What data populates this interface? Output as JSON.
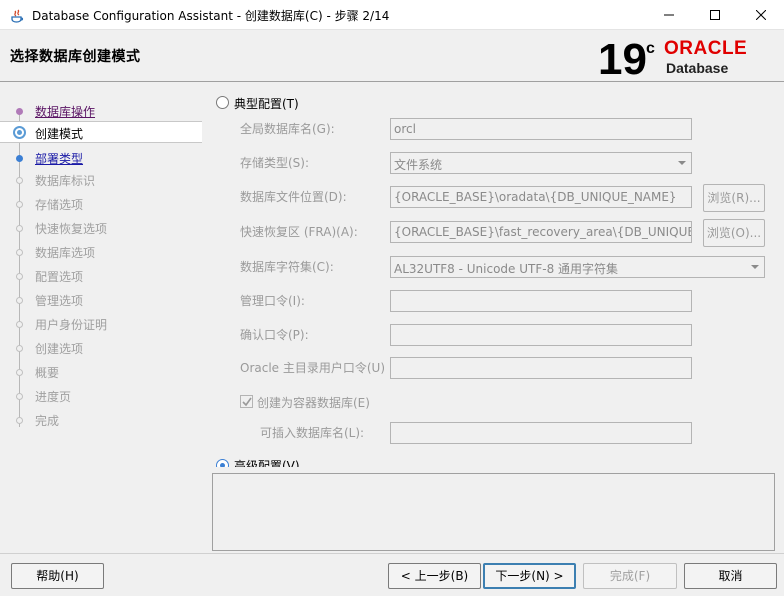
{
  "window": {
    "title": "Database Configuration Assistant - 创建数据库(C) - 步骤 2/14"
  },
  "header": {
    "heading": "选择数据库创建模式",
    "logo_version": "19",
    "logo_superscript": "c",
    "logo_brand": "ORACLE",
    "logo_product": "Database",
    "brand_color": "#e00000"
  },
  "nav": {
    "items": [
      {
        "label": "数据库操作",
        "state": "visited"
      },
      {
        "label": "创建模式",
        "state": "current"
      },
      {
        "label": "部署类型",
        "state": "link"
      },
      {
        "label": "数据库标识",
        "state": "disabled"
      },
      {
        "label": "存储选项",
        "state": "disabled"
      },
      {
        "label": "快速恢复选项",
        "state": "disabled"
      },
      {
        "label": "数据库选项",
        "state": "disabled"
      },
      {
        "label": "配置选项",
        "state": "disabled"
      },
      {
        "label": "管理选项",
        "state": "disabled"
      },
      {
        "label": "用户身份证明",
        "state": "disabled"
      },
      {
        "label": "创建选项",
        "state": "disabled"
      },
      {
        "label": "概要",
        "state": "disabled"
      },
      {
        "label": "进度页",
        "state": "disabled"
      },
      {
        "label": "完成",
        "state": "disabled"
      }
    ]
  },
  "form": {
    "typical_label": "典型配置(T)",
    "typical_selected": false,
    "global_db_name_label": "全局数据库名(G):",
    "global_db_name_value": "orcl",
    "storage_type_label": "存储类型(S):",
    "storage_type_value": "文件系统",
    "db_file_location_label": "数据库文件位置(D):",
    "db_file_location_value": "{ORACLE_BASE}\\oradata\\{DB_UNIQUE_NAME}",
    "browse_r_label": "浏览(R)...",
    "fra_label": "快速恢复区 (FRA)(A):",
    "fra_value": "{ORACLE_BASE}\\fast_recovery_area\\{DB_UNIQUE_NAME}",
    "browse_o_label": "浏览(O)...",
    "charset_label": "数据库字符集(C):",
    "charset_value": "AL32UTF8 - Unicode UTF-8 通用字符集",
    "admin_password_label": "管理口令(I):",
    "confirm_password_label": "确认口令(P):",
    "oracle_home_password_label": "Oracle 主目录用户口令(U)",
    "container_db_label": "创建为容器数据库(E)",
    "container_db_checked": true,
    "pdb_name_label": "可插入数据库名(L):",
    "advanced_label": "高级配置(V)",
    "advanced_selected": true
  },
  "footer": {
    "help_label": "帮助(H)",
    "back_label": "< 上一步(B)",
    "next_label": "下一步(N) >",
    "finish_label": "完成(F)",
    "cancel_label": "取消"
  }
}
